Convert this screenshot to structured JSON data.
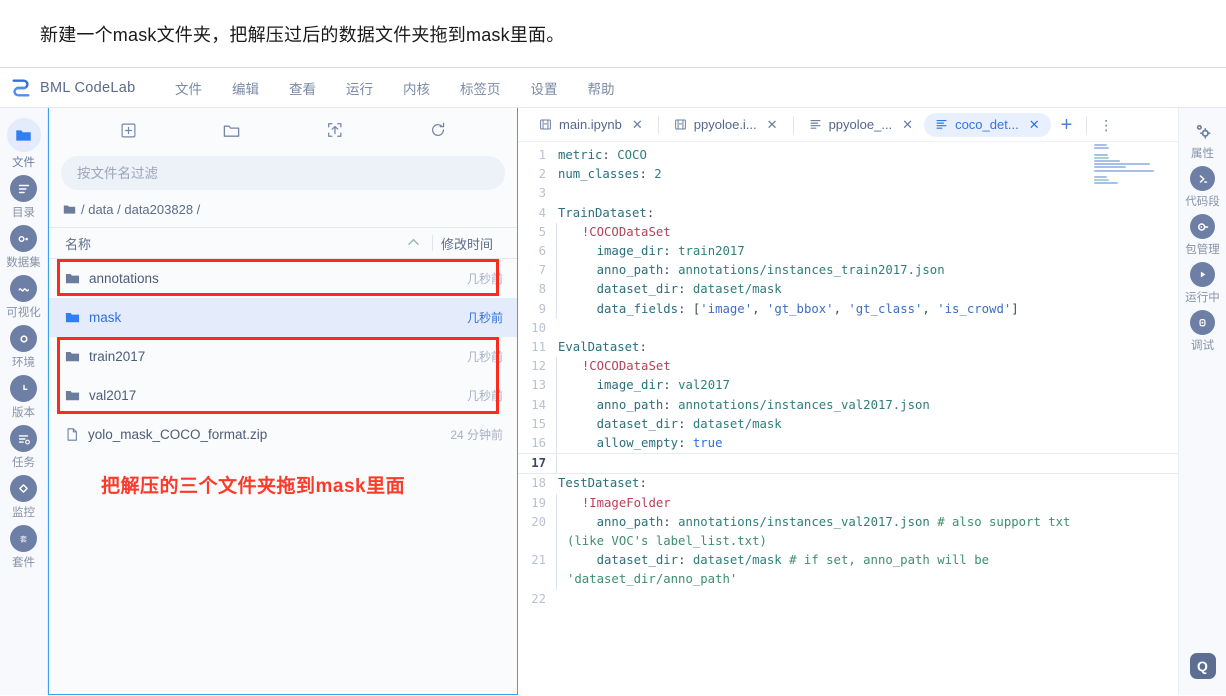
{
  "caption": {
    "text": "新建一个mask文件夹，把解压过后的数据文件夹拖到mask里面。"
  },
  "app": {
    "brand": "BML CodeLab",
    "menus": [
      "文件",
      "编辑",
      "查看",
      "运行",
      "内核",
      "标签页",
      "设置",
      "帮助"
    ]
  },
  "left_rail": [
    {
      "label": "文件",
      "icon": "folder-icon",
      "active": true
    },
    {
      "label": "目录",
      "icon": "list-icon",
      "active": false
    },
    {
      "label": "数据集",
      "icon": "dataset-icon",
      "active": false
    },
    {
      "label": "可视化",
      "icon": "wave-icon",
      "active": false
    },
    {
      "label": "环境",
      "icon": "circle-icon",
      "active": false
    },
    {
      "label": "版本",
      "icon": "clock-icon",
      "active": false
    },
    {
      "label": "任务",
      "icon": "task-icon",
      "active": false
    },
    {
      "label": "监控",
      "icon": "diamond-icon",
      "active": false
    },
    {
      "label": "套件",
      "icon": "suite-icon",
      "active": false
    }
  ],
  "file_panel": {
    "toolbar": [
      {
        "name": "new-launcher-icon"
      },
      {
        "name": "new-folder-icon"
      },
      {
        "name": "upload-icon"
      },
      {
        "name": "refresh-icon"
      }
    ],
    "search_placeholder": "按文件名过滤",
    "search_value": "",
    "breadcrumb": {
      "root_icon": "folder-icon",
      "parts": [
        "/",
        "data",
        "/",
        "data203828",
        "/"
      ],
      "text": "/ data / data203828 /"
    },
    "columns": {
      "name": "名称",
      "modified": "修改时间",
      "sort": "^"
    },
    "rows": [
      {
        "name": "annotations",
        "time": "几秒前",
        "type": "folder",
        "selected": false
      },
      {
        "name": "mask",
        "time": "几秒前",
        "type": "folder",
        "selected": true
      },
      {
        "name": "train2017",
        "time": "几秒前",
        "type": "folder",
        "selected": false
      },
      {
        "name": "val2017",
        "time": "几秒前",
        "type": "folder",
        "selected": false
      },
      {
        "name": "yolo_mask_COCO_format.zip",
        "time": "24 分钟前",
        "type": "file",
        "selected": false
      }
    ],
    "annotation_text": "把解压的三个文件夹拖到mask里面",
    "annotation_color": "#fb3a2a"
  },
  "editor": {
    "tabs": [
      {
        "label": "main.ipynb",
        "icon": "notebook-icon",
        "active": false,
        "close": "✕"
      },
      {
        "label": "ppyoloe.i...",
        "icon": "notebook-icon",
        "active": false,
        "close": "✕"
      },
      {
        "label": "ppyoloe_...",
        "icon": "textfile-icon",
        "active": false,
        "close": "✕"
      },
      {
        "label": "coco_det...",
        "icon": "textfile-icon",
        "active": true,
        "close": "✕"
      }
    ],
    "add_tab": "+",
    "kebab": "⋮",
    "lines": [
      {
        "n": 1,
        "cursor": false,
        "indent": false,
        "tokens": [
          {
            "t": "metric",
            "c": "k-key"
          },
          {
            "t": ": ",
            "c": "k-punc"
          },
          {
            "t": "COCO",
            "c": "k-val"
          }
        ]
      },
      {
        "n": 2,
        "cursor": false,
        "indent": false,
        "tokens": [
          {
            "t": "num_classes",
            "c": "k-key"
          },
          {
            "t": ": ",
            "c": "k-punc"
          },
          {
            "t": "2",
            "c": "k-num"
          }
        ]
      },
      {
        "n": 3,
        "cursor": false,
        "indent": false,
        "tokens": []
      },
      {
        "n": 4,
        "cursor": false,
        "indent": false,
        "tokens": [
          {
            "t": "TrainDataset",
            "c": "k-key"
          },
          {
            "t": ":",
            "c": "k-punc"
          }
        ]
      },
      {
        "n": 5,
        "cursor": false,
        "indent": true,
        "tokens": [
          {
            "t": "  !COCODataSet",
            "c": "k-tag"
          }
        ]
      },
      {
        "n": 6,
        "cursor": false,
        "indent": true,
        "tokens": [
          {
            "t": "    image_dir",
            "c": "k-key"
          },
          {
            "t": ": ",
            "c": "k-punc"
          },
          {
            "t": "train2017",
            "c": "k-val"
          }
        ]
      },
      {
        "n": 7,
        "cursor": false,
        "indent": true,
        "tokens": [
          {
            "t": "    anno_path",
            "c": "k-key"
          },
          {
            "t": ": ",
            "c": "k-punc"
          },
          {
            "t": "annotations/instances_train2017.json",
            "c": "k-val"
          }
        ]
      },
      {
        "n": 8,
        "cursor": false,
        "indent": true,
        "tokens": [
          {
            "t": "    dataset_dir",
            "c": "k-key"
          },
          {
            "t": ": ",
            "c": "k-punc"
          },
          {
            "t": "dataset/mask",
            "c": "k-val"
          }
        ]
      },
      {
        "n": 9,
        "cursor": false,
        "indent": true,
        "tokens": [
          {
            "t": "    data_fields",
            "c": "k-key"
          },
          {
            "t": ": [",
            "c": "k-punc"
          },
          {
            "t": "'image'",
            "c": "k-str"
          },
          {
            "t": ", ",
            "c": "k-punc"
          },
          {
            "t": "'gt_bbox'",
            "c": "k-str"
          },
          {
            "t": ", ",
            "c": "k-punc"
          },
          {
            "t": "'gt_class'",
            "c": "k-str"
          },
          {
            "t": ", ",
            "c": "k-punc"
          },
          {
            "t": "'is_crowd'",
            "c": "k-str"
          },
          {
            "t": "]",
            "c": "k-punc"
          }
        ]
      },
      {
        "n": 10,
        "cursor": false,
        "indent": false,
        "tokens": []
      },
      {
        "n": 11,
        "cursor": false,
        "indent": false,
        "tokens": [
          {
            "t": "EvalDataset",
            "c": "k-key"
          },
          {
            "t": ":",
            "c": "k-punc"
          }
        ]
      },
      {
        "n": 12,
        "cursor": false,
        "indent": true,
        "tokens": [
          {
            "t": "  !COCODataSet",
            "c": "k-tag"
          }
        ]
      },
      {
        "n": 13,
        "cursor": false,
        "indent": true,
        "tokens": [
          {
            "t": "    image_dir",
            "c": "k-key"
          },
          {
            "t": ": ",
            "c": "k-punc"
          },
          {
            "t": "val2017",
            "c": "k-val"
          }
        ]
      },
      {
        "n": 14,
        "cursor": false,
        "indent": true,
        "tokens": [
          {
            "t": "    anno_path",
            "c": "k-key"
          },
          {
            "t": ": ",
            "c": "k-punc"
          },
          {
            "t": "annotations/instances_val2017.json",
            "c": "k-val"
          }
        ]
      },
      {
        "n": 15,
        "cursor": false,
        "indent": true,
        "tokens": [
          {
            "t": "    dataset_dir",
            "c": "k-key"
          },
          {
            "t": ": ",
            "c": "k-punc"
          },
          {
            "t": "dataset/mask",
            "c": "k-val"
          }
        ]
      },
      {
        "n": 16,
        "cursor": false,
        "indent": true,
        "tokens": [
          {
            "t": "    allow_empty",
            "c": "k-key"
          },
          {
            "t": ": ",
            "c": "k-punc"
          },
          {
            "t": "true",
            "c": "k-bool"
          }
        ]
      },
      {
        "n": 17,
        "cursor": true,
        "indent": true,
        "tokens": []
      },
      {
        "n": 18,
        "cursor": false,
        "indent": false,
        "tokens": [
          {
            "t": "TestDataset",
            "c": "k-key"
          },
          {
            "t": ":",
            "c": "k-punc"
          }
        ]
      },
      {
        "n": 19,
        "cursor": false,
        "indent": true,
        "tokens": [
          {
            "t": "  !ImageFolder",
            "c": "k-tag"
          }
        ]
      },
      {
        "n": 20,
        "cursor": false,
        "indent": true,
        "tokens": [
          {
            "t": "    anno_path",
            "c": "k-key"
          },
          {
            "t": ": ",
            "c": "k-punc"
          },
          {
            "t": "annotations/instances_val2017.json ",
            "c": "k-val"
          },
          {
            "t": "# also support txt (like VOC's label_list.txt)",
            "c": "k-cmt"
          }
        ]
      },
      {
        "n": 21,
        "cursor": false,
        "indent": true,
        "tokens": [
          {
            "t": "    dataset_dir",
            "c": "k-key"
          },
          {
            "t": ": ",
            "c": "k-punc"
          },
          {
            "t": "dataset/mask ",
            "c": "k-val"
          },
          {
            "t": "# if set, anno_path will be 'dataset_dir/anno_path'",
            "c": "k-cmt"
          }
        ]
      },
      {
        "n": 22,
        "cursor": false,
        "indent": false,
        "tokens": []
      }
    ]
  },
  "right_rail": [
    {
      "label": "属性",
      "icon": "gear-icon"
    },
    {
      "label": "代码段",
      "icon": "snippet-icon"
    },
    {
      "label": "包管理",
      "icon": "package-icon"
    },
    {
      "label": "运行中",
      "icon": "play-icon"
    },
    {
      "label": "调试",
      "icon": "debug-icon"
    }
  ],
  "help_button": {
    "label": "Q",
    "name": "help-icon"
  },
  "colors": {
    "accent": "#3272e8",
    "panel_border": "#3aa3e8",
    "annotation_red": "#fb2c1d",
    "rail_bg": "#f7f9fc",
    "selected_bg": "#e4ecfb"
  }
}
